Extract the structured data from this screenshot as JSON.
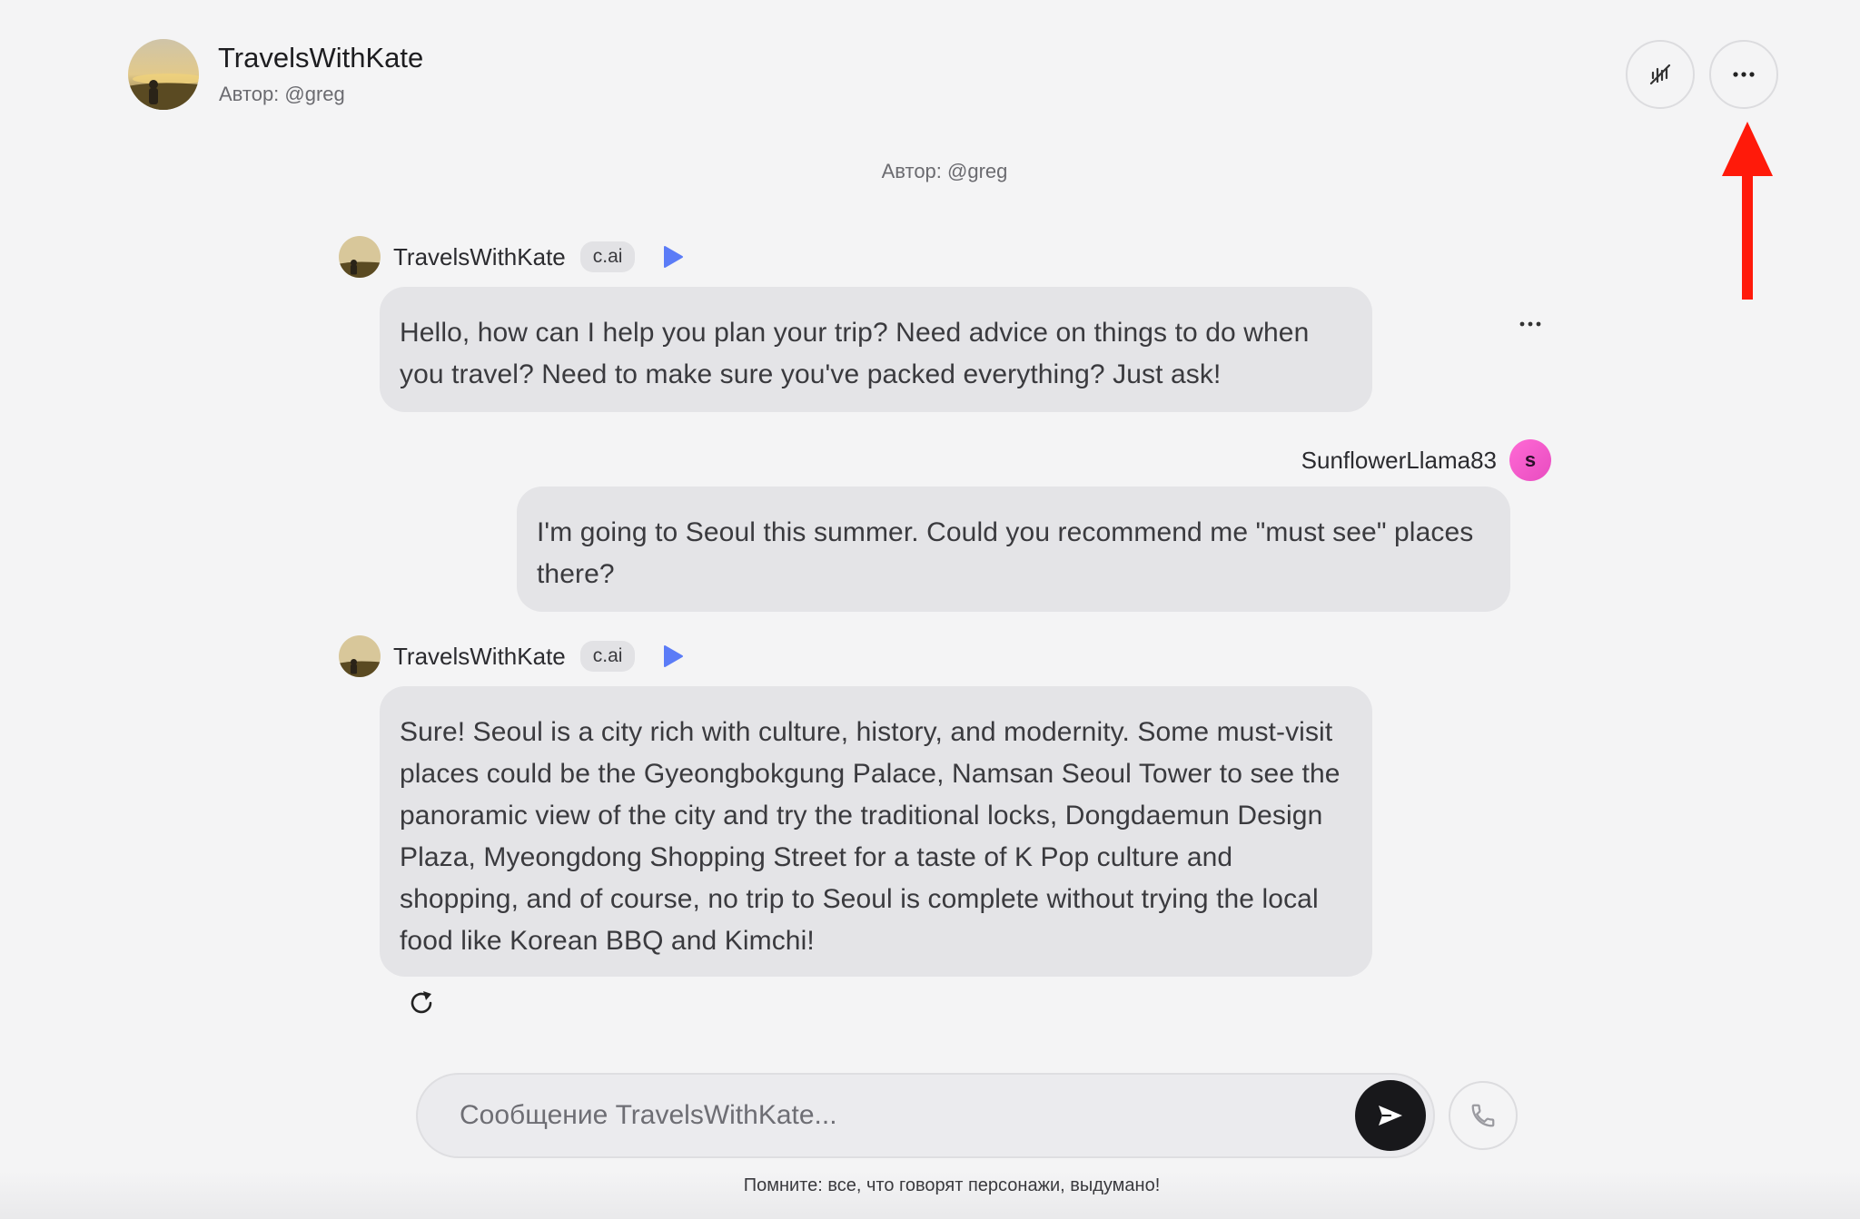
{
  "header": {
    "character_name": "TravelsWithKate",
    "author": "Автор: @greg"
  },
  "center_author": "Автор: @greg",
  "icons": {
    "mute": "mute-icon",
    "more": "more-dots-icon",
    "play": "play-icon",
    "regenerate": "refresh-icon",
    "send": "send-icon",
    "call": "phone-icon"
  },
  "colors": {
    "play_accent": "#5b7cf7",
    "annotation_arrow": "#ff1a0a",
    "send_button": "#18181b",
    "user_avatar": "#f05fd0"
  },
  "messages": [
    {
      "sender": "TravelsWithKate",
      "badge": "c.ai",
      "text": "Hello, how can I help you plan your trip? Need advice on things to do when you travel? Need to make sure you've packed everything? Just ask!"
    },
    {
      "sender": "SunflowerLlama83",
      "avatar_letter": "s",
      "text": "I'm going to Seoul this summer. Could you recommend me \"must see\" places there?"
    },
    {
      "sender": "TravelsWithKate",
      "badge": "c.ai",
      "text": "Sure! Seoul is a city rich with culture, history, and modernity. Some must-visit places could be the Gyeongbokgung Palace, Namsan Seoul Tower to see the panoramic view of the city and try the traditional locks, Dongdaemun Design Plaza, Myeongdong Shopping Street for a taste of K Pop culture and shopping, and of course, no trip to Seoul is complete without trying the local food like Korean BBQ and Kimchi!"
    }
  ],
  "input": {
    "placeholder": "Сообщение TravelsWithKate...",
    "value": ""
  },
  "disclaimer": "Помните: все, что говорят персонажи, выдумано!"
}
